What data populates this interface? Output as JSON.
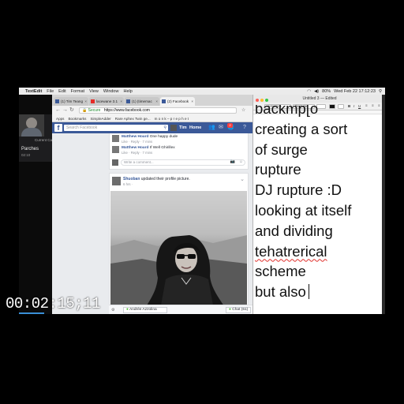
{
  "menubar": {
    "app": "TextEdit",
    "items": [
      "File",
      "Edit",
      "Format",
      "View",
      "Window",
      "Help"
    ],
    "clock": "Wed Feb 22  17:12:23",
    "battery": "80%"
  },
  "call": {
    "title": "Current Call",
    "name": "Parches",
    "duration": "02:10"
  },
  "chrome": {
    "tabs": [
      {
        "label": "(1) Tim Teang"
      },
      {
        "label": "lacewane 3.1"
      },
      {
        "label": "(1) (timemac"
      },
      {
        "label": "(2) Facebook"
      }
    ],
    "tab_close": "×",
    "address_secure": "Secure",
    "address_url": "https://www.facebook.com",
    "bookmarks": [
      "Apps",
      "Bookmarks",
      "SimpleAdder",
      "Rare Aphex Twin ge...",
      "m o n k – p r e p h e t"
    ]
  },
  "facebook": {
    "logo": "f",
    "search_placeholder": "Search Facebook",
    "user_name": "Tim",
    "home_label": "Home",
    "notification_count": "2",
    "comments": [
      {
        "author": "Matthew Hoard",
        "text": "One happy dude",
        "meta": "Like · Reply · 7 mins"
      },
      {
        "author": "Matthew Hoard",
        "text": "If Well Ghirillex",
        "meta": "Like · Reply · 7 mins"
      }
    ],
    "write_comment_placeholder": "Write a comment...",
    "post_author": "Shuoban",
    "post_action": "updated their profile picture.",
    "post_time": "6 hrs · ",
    "chat_friend": "Andrée Azzolina",
    "chat_label": "Chat (61)"
  },
  "textedit": {
    "window_title": "Untitled 3 — Edited",
    "font_family_select": "Helvetica",
    "font_style_select": "Regular",
    "lines": [
      "backmp[o",
      "creating a sort",
      "of surge",
      "rupture",
      "DJ rupture :D",
      "looking at itself",
      "and dividing",
      "tehatrerical",
      "scheme",
      "but also"
    ]
  },
  "overlay": {
    "timecode": "00:02:15;11"
  }
}
